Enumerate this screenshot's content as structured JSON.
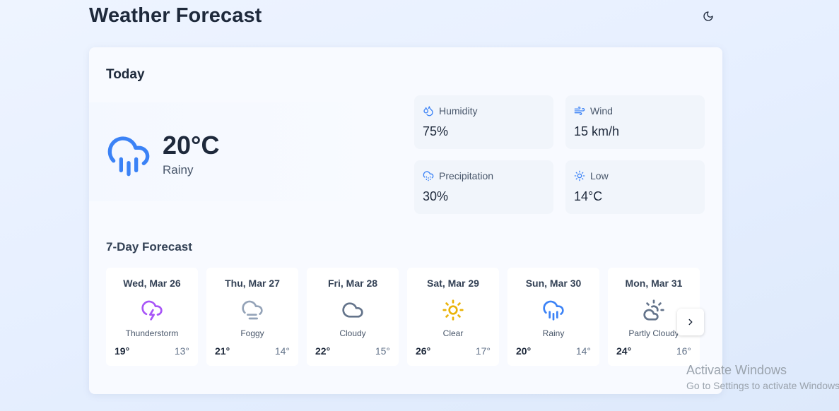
{
  "header": {
    "title": "Weather Forecast",
    "theme_toggle_icon": "moon-icon"
  },
  "today": {
    "title": "Today",
    "icon": "cloud-rain-icon",
    "temperature": "20°C",
    "condition": "Rainy",
    "stats": [
      {
        "icon": "droplets-icon",
        "label": "Humidity",
        "value": "75%"
      },
      {
        "icon": "wind-icon",
        "label": "Wind",
        "value": "15 km/h"
      },
      {
        "icon": "cloud-drizzle-icon",
        "label": "Precipitation",
        "value": "30%"
      },
      {
        "icon": "sun-icon",
        "label": "Low",
        "value": "14°C"
      }
    ]
  },
  "forecast": {
    "title": "7-Day Forecast",
    "days": [
      {
        "day": "Wed, Mar 26",
        "icon": "cloud-lightning-icon",
        "condition": "Thunderstorm",
        "high": "19°",
        "low": "13°"
      },
      {
        "day": "Thu, Mar 27",
        "icon": "cloud-fog-icon",
        "condition": "Foggy",
        "high": "21°",
        "low": "14°"
      },
      {
        "day": "Fri, Mar 28",
        "icon": "cloud-icon",
        "condition": "Cloudy",
        "high": "22°",
        "low": "15°"
      },
      {
        "day": "Sat, Mar 29",
        "icon": "sun-icon",
        "condition": "Clear",
        "high": "26°",
        "low": "17°"
      },
      {
        "day": "Sun, Mar 30",
        "icon": "cloud-rain-icon",
        "condition": "Rainy",
        "high": "20°",
        "low": "14°"
      },
      {
        "day": "Mon, Mar 31",
        "icon": "cloud-sun-icon",
        "condition": "Partly Cloudy",
        "high": "24°",
        "low": "16°"
      }
    ],
    "next_icon": "chevron-right-icon"
  },
  "colors": {
    "rain": "#3b82f6",
    "thunder": "#a855f7",
    "fog": "#94a3b8",
    "cloud": "#64748b",
    "sun": "#eab308"
  },
  "watermark": {
    "line1": "Activate Windows",
    "line2": "Go to Settings to activate Windows."
  }
}
